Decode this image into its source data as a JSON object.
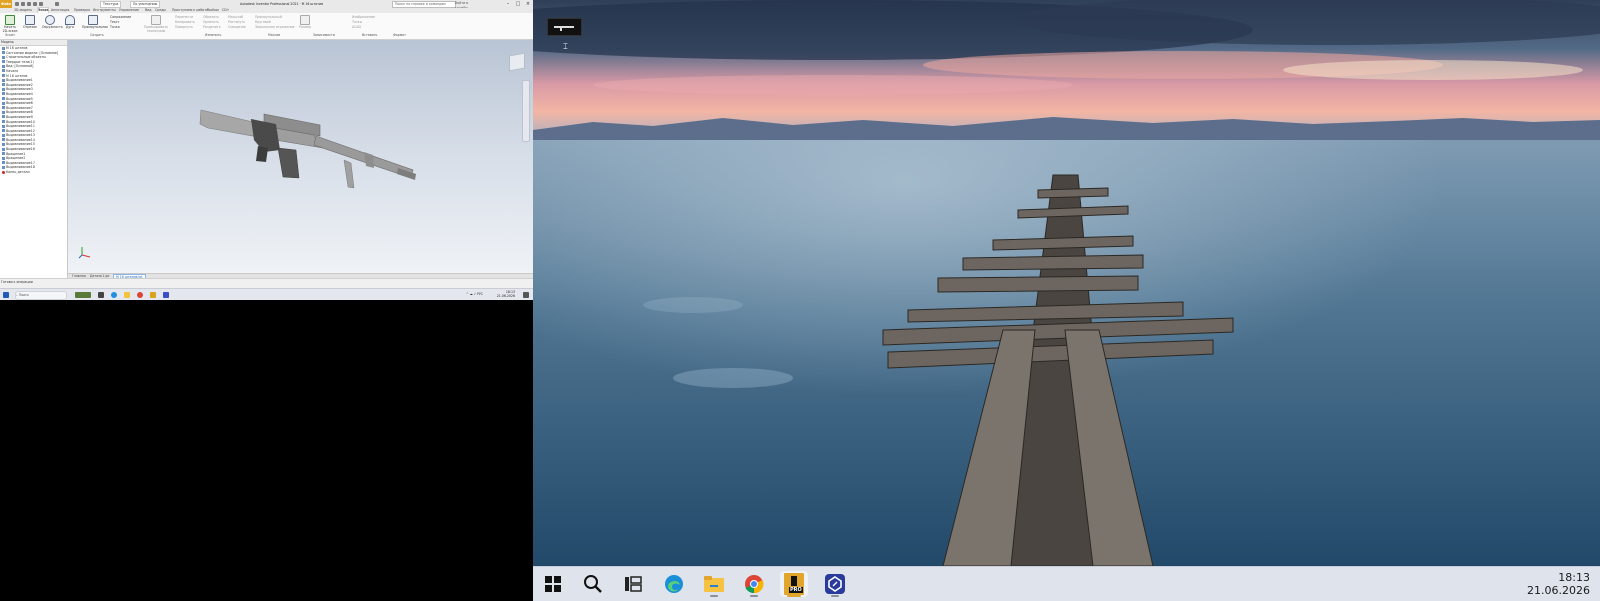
{
  "inventor": {
    "title": "Autodesk Inventor Professional 2021 · M 16 штатив",
    "file_tab": "Файл",
    "qat": {
      "appearance": "Текстура",
      "material": "По умолчанию"
    },
    "search_placeholder": "Поиск по справке и командам",
    "help": "Войти в службы",
    "tabs": [
      "3D-модель",
      "Эскиз",
      "Аннотация",
      "Проверка",
      "Инструменты",
      "Управление",
      "Вид",
      "Среды",
      "Приступаем к работе",
      "Toolbox",
      "CD+"
    ],
    "active_tab": "Эскиз",
    "ribbon": {
      "finish": "Начать 2D-эскиз",
      "line": "Отрезок",
      "circle": "Окружность",
      "arc": "Дуга",
      "rectangle": "Прямоугольник",
      "fillet": "Сопряжение",
      "text": "Текст",
      "point": "Точка",
      "project_geometry": "Проецировать геометрию",
      "move": "Перенести",
      "copy": "Копировать",
      "rotate": "Повернуть",
      "trim": "Обрезать",
      "extend": "Удлинить",
      "split": "Разделить",
      "scale": "Масштаб",
      "stretch": "Растянуть",
      "offset": "Смещение",
      "rect_array": "Прямоугольный",
      "circ_array": "Круговой",
      "mirror": "Зеркальное отражение",
      "dimension": "Размер",
      "image": "Изображение",
      "points": "Точки",
      "acad": "ACAD",
      "groups": [
        "Эскиз",
        "Создать",
        "Изменить",
        "Массив",
        "Зависимости",
        "Вставить",
        "Формат"
      ]
    },
    "browser": {
      "head": "Модель",
      "items": [
        "М 16 штатив",
        "Состояния модели: [Основное]",
        "Строительные объекты",
        "Твердые тела(1)",
        "Вид: [Основной]",
        "Начало",
        "М 16 штатив",
        "Выдавливание1",
        "Выдавливание2",
        "Выдавливание3",
        "Выдавливание4",
        "Выдавливание5",
        "Выдавливание6",
        "Выдавливание7",
        "Выдавливание8",
        "Выдавливание9",
        "Выдавливание10",
        "Выдавливание11",
        "Выдавливание12",
        "Выдавливание13",
        "Выдавливание14",
        "Выдавливание15",
        "Выдавливание16",
        "Вращение1",
        "Вращение2",
        "Выдавливание17",
        "Выдавливание18",
        "Конец детали"
      ]
    },
    "doc_tabs": [
      "Главная",
      "Деталь1.ipt",
      "М 16 штатив.ipt"
    ],
    "status": "Готово к операции",
    "taskbar_search": "Поиск",
    "tray": "РУС",
    "clock_time": "18:13",
    "clock_date": "21.06.2026"
  },
  "desktop": {
    "clock_time": "18:13",
    "clock_date": "21.06.2026",
    "taskbar_icons": [
      "windows-start-icon",
      "search-icon",
      "task-view-icon",
      "edge-icon",
      "file-explorer-icon",
      "chrome-icon",
      "inventor-pro-icon",
      "app-icon"
    ],
    "inventor_badge": "PRO"
  }
}
